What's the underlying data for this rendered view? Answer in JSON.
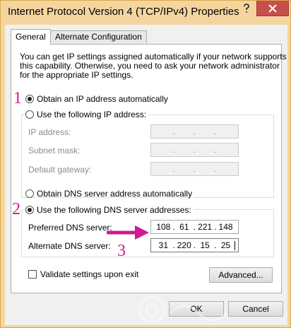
{
  "window": {
    "title": "Internet Protocol Version 4 (TCP/IPv4) Properties",
    "help_label": "?"
  },
  "tabs": [
    {
      "label": "General",
      "active": true
    },
    {
      "label": "Alternate Configuration",
      "active": false
    }
  ],
  "description": {
    "line1": "You can get IP settings assigned automatically if your network supports",
    "line2": "this capability. Otherwise, you need to ask your network administrator",
    "line3": "for the appropriate IP settings."
  },
  "ip": {
    "auto_label": "Obtain an IP address automatically",
    "manual_label": "Use the following IP address:",
    "auto_selected": true,
    "fields": [
      {
        "label": "IP address:",
        "segments": [
          "",
          "",
          "",
          ""
        ]
      },
      {
        "label": "Subnet mask:",
        "segments": [
          "",
          "",
          "",
          ""
        ]
      },
      {
        "label": "Default gateway:",
        "segments": [
          "",
          "",
          "",
          ""
        ]
      }
    ]
  },
  "dns": {
    "auto_label": "Obtain DNS server address automatically",
    "manual_label": "Use the following DNS server addresses:",
    "manual_selected": true,
    "preferred": {
      "label": "Preferred DNS server:",
      "segments": [
        "108",
        "61",
        "221",
        "148"
      ]
    },
    "alternate": {
      "label": "Alternate DNS server:",
      "segments": [
        "31",
        "220",
        "15",
        "25"
      ]
    }
  },
  "validate_label": "Validate settings upon exit",
  "buttons": {
    "advanced": "Advanced...",
    "ok": "OK",
    "cancel": "Cancel"
  },
  "annotations": {
    "step1": "1",
    "step2": "2",
    "step3": "3",
    "accent_color": "#d01a8e"
  }
}
